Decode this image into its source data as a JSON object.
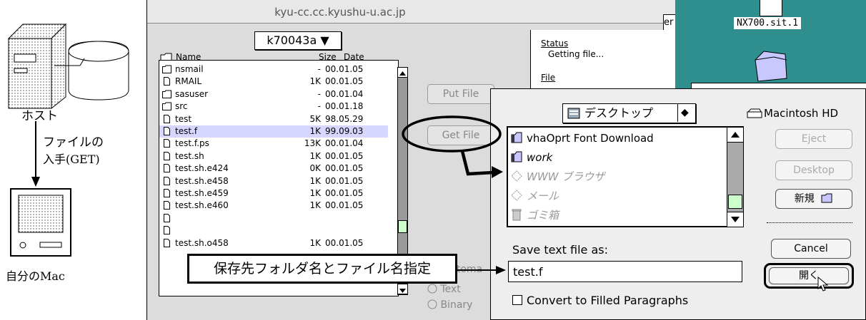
{
  "diagram": {
    "host_label": "ホスト",
    "arrow_label_line1": "ファイルの",
    "arrow_label_line2": "入手(GET)",
    "mac_label": "自分のMac"
  },
  "ftp": {
    "window_title": "kyu-cc.cc.kyushu-u.ac.jp",
    "directory_popup": "k70043a ▼",
    "col_name": "Name",
    "col_size": "Size",
    "col_date": "Date",
    "files": [
      {
        "name": "nsmail",
        "size": "-",
        "date": "00.01.05",
        "kind": "folder"
      },
      {
        "name": "RMAIL",
        "size": "1K",
        "date": "00.01.05",
        "kind": "file"
      },
      {
        "name": "sasuser",
        "size": "-",
        "date": "00.01.04",
        "kind": "folder"
      },
      {
        "name": "src",
        "size": "-",
        "date": "00.01.18",
        "kind": "folder"
      },
      {
        "name": "test",
        "size": "5K",
        "date": "98.05.29",
        "kind": "file"
      },
      {
        "name": "test.f",
        "size": "1K",
        "date": "99.09.03",
        "kind": "file"
      },
      {
        "name": "test.f.ps",
        "size": "13K",
        "date": "00.01.04",
        "kind": "file"
      },
      {
        "name": "test.sh",
        "size": "1K",
        "date": "00.01.05",
        "kind": "file"
      },
      {
        "name": "test.sh.e424",
        "size": "0K",
        "date": "00.01.05",
        "kind": "file"
      },
      {
        "name": "test.sh.e458",
        "size": "1K",
        "date": "00.01.05",
        "kind": "file"
      },
      {
        "name": "test.sh.e459",
        "size": "1K",
        "date": "00.01.05",
        "kind": "file"
      },
      {
        "name": "test.sh.e460",
        "size": "1K",
        "date": "00.01.05",
        "kind": "file"
      },
      {
        "name": "",
        "size": "",
        "date": "",
        "kind": "file"
      },
      {
        "name": "",
        "size": "",
        "date": "",
        "kind": "file"
      },
      {
        "name": "test.sh.o458",
        "size": "1K",
        "date": "00.01.05",
        "kind": "file"
      }
    ],
    "selected_index": 5,
    "put_button": "Put File",
    "get_button": "Get File",
    "status_heading": "Status",
    "status_text": "Getting file...",
    "file_heading": "File",
    "mode_partial": "utoma",
    "mode_text": "Text",
    "mode_binary": "Binary",
    "behind_button_fragment": "er"
  },
  "desktop": {
    "file_label": "NX700.sit.1",
    "accent": "#2f8f8f"
  },
  "save_dialog": {
    "location_popup": "デスクトップ",
    "volume_name": "Macintosh HD",
    "items": [
      {
        "label": "vhaOprt Font Download",
        "enabled": true,
        "icon": "folder-icon"
      },
      {
        "label": "work",
        "enabled": true,
        "icon": "folder-icon"
      },
      {
        "label": "WWW ブラウザ",
        "enabled": false,
        "icon": "alias-icon"
      },
      {
        "label": "メール",
        "enabled": false,
        "icon": "alias-icon"
      },
      {
        "label": "ゴミ箱",
        "enabled": false,
        "icon": "trash-icon"
      }
    ],
    "eject_button": "Eject",
    "desktop_button": "Desktop",
    "new_button": "新規",
    "cancel_button": "Cancel",
    "open_button": "開く",
    "prompt": "Save text file as:",
    "filename_value": "test.f",
    "convert_checkbox": "Convert to Filled Paragraphs"
  },
  "callout": {
    "text": "保存先フォルダ名とファイル名指定"
  }
}
